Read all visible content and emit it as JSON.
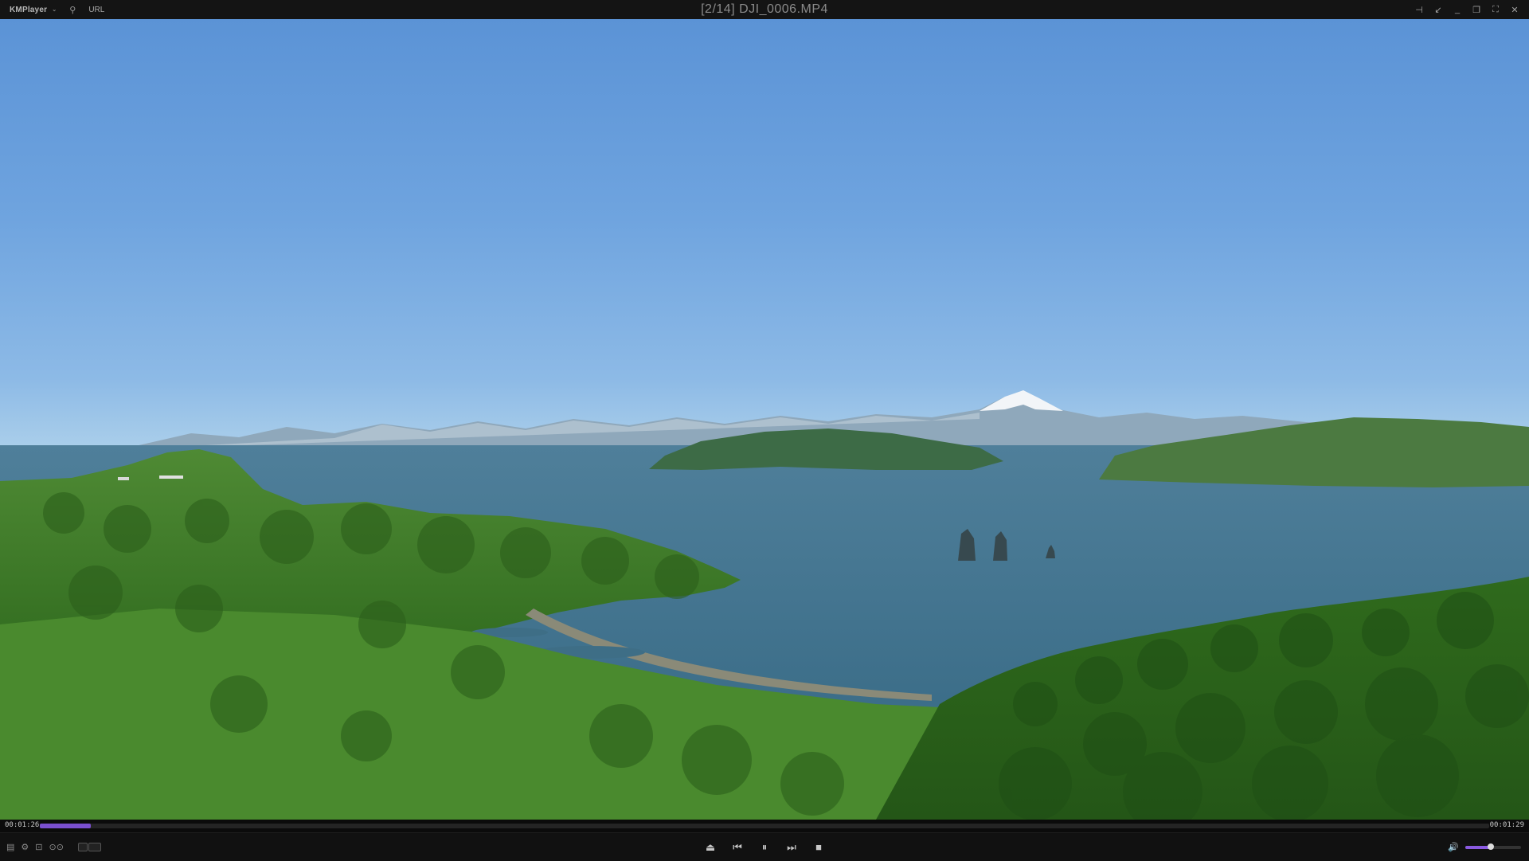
{
  "app": {
    "name": "KMPlayer",
    "url_label": "URL"
  },
  "title": "[2/14] DJI_0006.MP4",
  "playback": {
    "current_time": "00:01:26",
    "total_time": "00:01:29",
    "progress": 0.035,
    "volume": 0.45
  },
  "accent_color": "#7a4fcf",
  "controls": {
    "left_icons": [
      "playlist-icon",
      "settings-icon",
      "capture-icon",
      "vr-icon"
    ],
    "center_icons": [
      "eject-icon",
      "previous-icon",
      "pause-icon",
      "next-icon",
      "stop-icon"
    ],
    "window_icons": [
      "pin-icon",
      "mini-mode-icon",
      "minimize-icon",
      "restore-icon",
      "fullscreen-icon",
      "close-icon"
    ]
  }
}
